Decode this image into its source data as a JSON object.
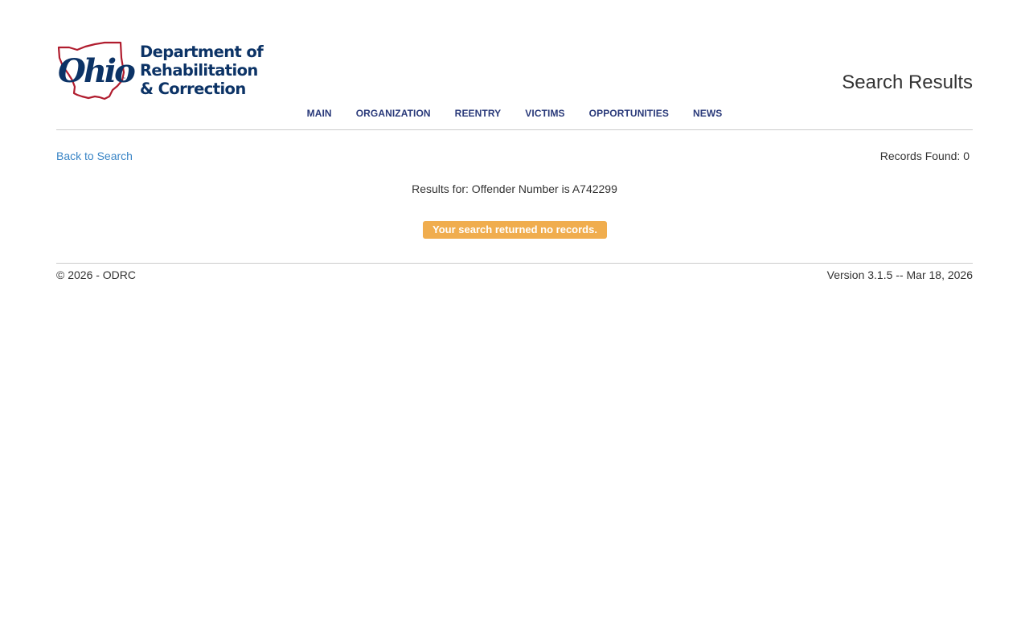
{
  "header": {
    "logo": {
      "wordmark": "Ohio",
      "line1": "Department of",
      "line2": "Rehabilitation",
      "line3": "& Correction",
      "brand_blue": "#0c3366",
      "brand_red": "#b01c2e"
    },
    "page_title": "Search Results",
    "nav": [
      {
        "label": "MAIN"
      },
      {
        "label": "ORGANIZATION"
      },
      {
        "label": "REENTRY"
      },
      {
        "label": "VICTIMS"
      },
      {
        "label": "OPPORTUNITIES"
      },
      {
        "label": "NEWS"
      }
    ]
  },
  "results": {
    "back_link": "Back to Search",
    "records_found": "Records Found: 0",
    "results_for": "Results for: Offender Number is A742299",
    "no_records_message": "Your search returned no records.",
    "alert_color": "#f0ad4e"
  },
  "footer": {
    "copyright": "© 2026 - ODRC",
    "version": "Version 3.1.5 -- Mar 18, 2026"
  }
}
